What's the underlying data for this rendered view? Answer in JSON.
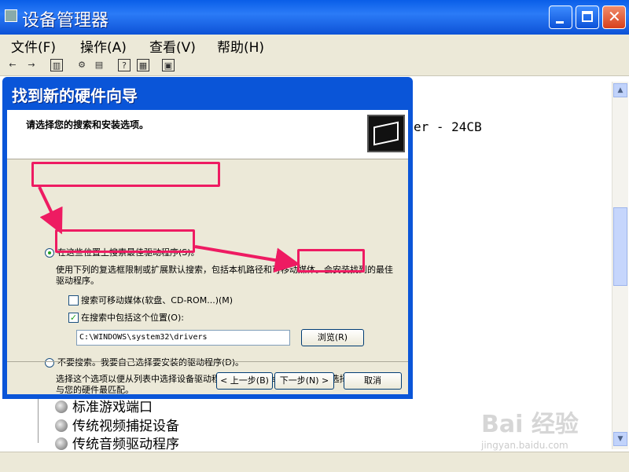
{
  "window": {
    "title": "设备管理器",
    "menu": [
      "文件(F)",
      "操作(A)",
      "查看(V)",
      "帮助(H)"
    ],
    "partial_device_text": "er - 24CB",
    "tree_items": [
      "标准游戏端口",
      "传统视频捕捉设备",
      "传统音频驱动程序"
    ]
  },
  "dialog": {
    "title": "找到新的硬件向导",
    "heading": "请选择您的搜索和安装选项。",
    "option_search_label": "在这些位置上搜索最佳驱动程序(S)。",
    "option_search_desc": "使用下列的复选框限制或扩展默认搜索，包括本机路径和可移动媒体。会安装找到的最佳驱动程序。",
    "check_removable_label": "搜索可移动媒体(软盘、CD-ROM...)(M)",
    "check_include_label": "在搜索中包括这个位置(O):",
    "path_value": "C:\\WINDOWS\\system32\\drivers",
    "browse_label": "浏览(R)",
    "option_nosearch_label": "不要搜索。我要自己选择要安装的驱动程序(D)。",
    "option_nosearch_desc": "选择这个选项以便从列表中选择设备驱动程序。Windows 不能保证您所选择的驱动程序与您的硬件最匹配。",
    "back_label": "< 上一步(B)",
    "next_label": "下一步(N) >",
    "cancel_label": "取消"
  },
  "watermark": {
    "logo": "Bai 经验",
    "url": "jingyan.baidu.com"
  },
  "colors": {
    "highlight": "#ee1b62",
    "titlebar": "#0a5ee8"
  }
}
